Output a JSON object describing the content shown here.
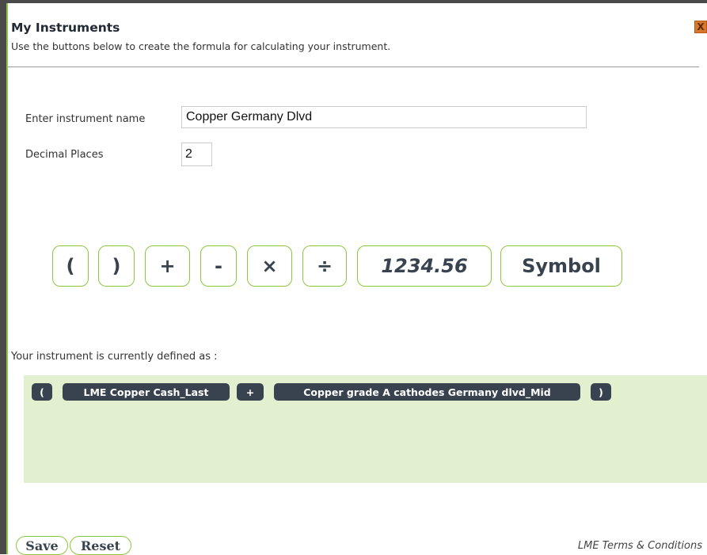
{
  "dialog": {
    "title": "My Instruments",
    "subtitle": "Use the buttons below to create the formula for calculating your instrument.",
    "close_label": "X"
  },
  "form": {
    "name_label": "Enter instrument name",
    "name_value": "Copper Germany Dlvd",
    "decimals_label": "Decimal Places",
    "decimals_value": "2"
  },
  "operators": {
    "open_paren": "(",
    "close_paren": ")",
    "plus": "+",
    "minus": "-",
    "times": "×",
    "divide": "÷",
    "number": "1234.56",
    "symbol": "Symbol"
  },
  "formula": {
    "label": "Your instrument is currently defined as :",
    "tokens": [
      "(",
      "LME Copper Cash_Last",
      "+",
      "Copper grade A cathodes Germany dlvd_Mid",
      ")"
    ]
  },
  "footer": {
    "save_label": "Save",
    "reset_label": "Reset",
    "terms_label": "LME Terms & Conditions"
  },
  "colors": {
    "accent_green": "#8dc63f",
    "token_dark": "#39434f",
    "formula_bg": "#e2f0cf",
    "close_orange": "#d9772b"
  }
}
